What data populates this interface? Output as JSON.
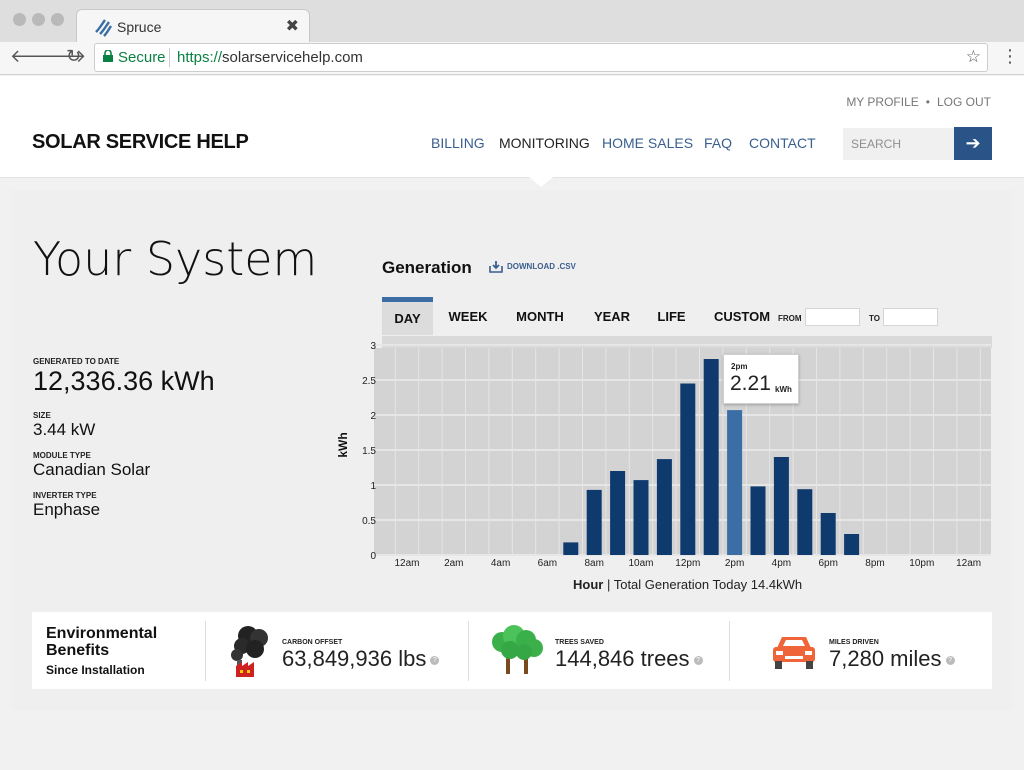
{
  "browser": {
    "tab_title": "Spruce",
    "secure_label": "Secure",
    "url_scheme": "https://",
    "url_host": "solarservicehelp.com",
    "close_glyph": "✖",
    "back_glyph": "🡐",
    "forward_glyph": "🡒",
    "reload_glyph": "↻",
    "star_glyph": "☆",
    "menu_glyph": "⋮"
  },
  "header": {
    "brand": "SOLAR SERVICE HELP",
    "my_profile": "MY PROFILE",
    "dot": "•",
    "log_out": "LOG OUT",
    "nav": [
      "BILLING",
      "MONITORING",
      "HOME SALES",
      "FAQ",
      "CONTACT"
    ],
    "active_nav": "MONITORING",
    "search_placeholder": "SEARCH",
    "search_arrow": "➔"
  },
  "system": {
    "title": "Your System",
    "generated_label": "GENERATED TO DATE",
    "generated_value": "12,336.36 kWh",
    "size_label": "SIZE",
    "size_value": "3.44 kW",
    "module_label": "MODULE TYPE",
    "module_value": "Canadian Solar",
    "inverter_label": "INVERTER TYPE",
    "inverter_value": "Enphase"
  },
  "generation": {
    "title": "Generation",
    "download_label": "DOWNLOAD .CSV",
    "tabs": [
      "DAY",
      "WEEK",
      "MONTH",
      "YEAR",
      "LIFE",
      "CUSTOM"
    ],
    "active_tab": "DAY",
    "from_label": "FROM",
    "to_label": "TO",
    "tooltip_time": "2pm",
    "tooltip_value": "2.21",
    "tooltip_unit": "kWh",
    "footer_bold": "Hour",
    "footer_sep": " | ",
    "footer_text": "Total Generation Today 14.4kWh"
  },
  "chart_data": {
    "type": "bar",
    "ylabel": "kWh",
    "xlabel": "Hour",
    "ylim": [
      0,
      3
    ],
    "yticks": [
      "0",
      "0.5",
      "1",
      "1.5",
      "2",
      "2.5",
      "3"
    ],
    "categories": [
      "12am",
      "1am",
      "2am",
      "3am",
      "4am",
      "5am",
      "6am",
      "7am",
      "8am",
      "9am",
      "10am",
      "11am",
      "12pm",
      "1pm",
      "2pm",
      "3pm",
      "4pm",
      "5pm",
      "6pm",
      "7pm",
      "8pm",
      "9pm",
      "10pm",
      "11pm",
      "12am"
    ],
    "xtick_labels": [
      "12am",
      "2am",
      "4am",
      "6am",
      "8am",
      "10am",
      "12pm",
      "2pm",
      "4pm",
      "6pm",
      "8pm",
      "10pm",
      "12am"
    ],
    "values": [
      0,
      0,
      0,
      0,
      0,
      0,
      0,
      0.18,
      0.93,
      1.2,
      1.07,
      1.37,
      2.45,
      2.8,
      2.07,
      0.98,
      1.4,
      0.94,
      0.6,
      0.3,
      0,
      0,
      0,
      0,
      0
    ],
    "highlight_index": 14,
    "bar_color": "#0f3a6e",
    "highlight_color": "#3a6ea5",
    "grid": true
  },
  "environment": {
    "title": "Environmental Benefits",
    "subtitle": "Since Installation",
    "carbon_label": "CARBON OFFSET",
    "carbon_value": "63,849,936 lbs",
    "trees_label": "TREES SAVED",
    "trees_value": "144,846 trees",
    "miles_label": "MILES DRIVEN",
    "miles_value": "7,280 miles",
    "help_glyph": "?"
  }
}
